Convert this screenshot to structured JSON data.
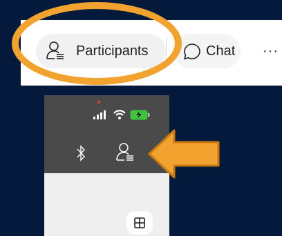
{
  "toolbar": {
    "participants_label": "Participants",
    "chat_label": "Chat",
    "more_label": "···"
  },
  "colors": {
    "background": "#031a3c",
    "highlight": "#f2a22e",
    "phone_dark": "#4a4a4a",
    "phone_light": "#efefef",
    "battery": "#3ec43e"
  },
  "icons": [
    "participants-icon",
    "chat-icon",
    "more-icon",
    "signal-icon",
    "wifi-icon",
    "battery-icon",
    "bluetooth-icon",
    "grid-icon",
    "arrow-icon"
  ]
}
